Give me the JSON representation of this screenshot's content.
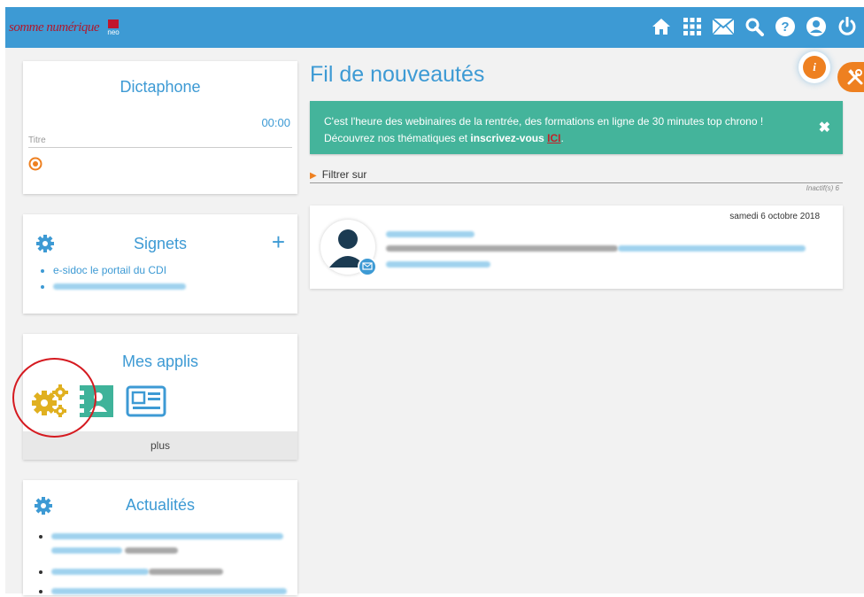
{
  "header": {
    "logo_text": "somme numérique",
    "logo_badge": "neo",
    "icons": [
      "home-icon",
      "apps-grid-icon",
      "mail-icon",
      "search-icon",
      "help-icon",
      "user-icon",
      "power-icon"
    ],
    "color": "#3d9ad4"
  },
  "dictaphone": {
    "title": "Dictaphone",
    "time": "00:00",
    "title_placeholder": "Titre"
  },
  "signets": {
    "title": "Signets",
    "items": [
      "e-sidoc le portail du CDI"
    ]
  },
  "apps": {
    "title": "Mes applis",
    "more_label": "plus"
  },
  "actualites": {
    "title": "Actualités"
  },
  "feed": {
    "title": "Fil de nouveautés",
    "banner_text_part1": "C'est l'heure des webinaires de la rentrée, des formations en ligne de 30 minutes top chrono ! Découvrez nos thématiques et ",
    "banner_strong": "inscrivez-vous",
    "banner_link": "ICI",
    "banner_end": ".",
    "banner_close": "✖",
    "filter_label": "Filtrer sur",
    "inactive_label": "Inactif(s) 6",
    "post_date": "samedi 6 octobre 2018",
    "banner_color": "#44b49b",
    "accent_color": "#ee8020"
  },
  "info_bubble": {
    "label": "i"
  }
}
